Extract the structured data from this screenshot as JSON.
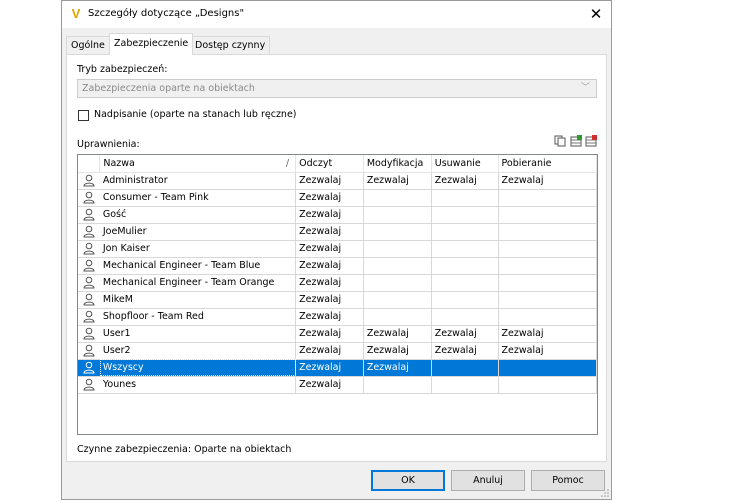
{
  "window": {
    "title": "Szczegóły dotyczące „Designs\"",
    "app_icon": "vault-v-icon",
    "close_glyph": "✕"
  },
  "tabs": [
    {
      "label": "Ogólne",
      "active": false
    },
    {
      "label": "Zabezpieczenie",
      "active": true
    },
    {
      "label": "Dostęp czynny",
      "active": false
    }
  ],
  "security": {
    "mode_label": "Tryb zabezpieczeń:",
    "mode_value": "Zabezpieczenia oparte na obiektach",
    "override_label": "Nadpisanie (oparte na stanach lub ręczne)",
    "override_checked": false,
    "permissions_label": "Uprawnienia:",
    "toolbar_icons": [
      "copy-icon",
      "add-entry-icon",
      "remove-entry-icon"
    ]
  },
  "grid": {
    "columns": [
      "Nazwa",
      "Odczyt",
      "Modyfikacja",
      "Usuwanie",
      "Pobieranie"
    ],
    "sort_marker": "/",
    "rows": [
      {
        "name": "Administrator",
        "read": "Zezwalaj",
        "modify": "Zezwalaj",
        "delete": "Zezwalaj",
        "download": "Zezwalaj"
      },
      {
        "name": "Consumer - Team Pink",
        "read": "Zezwalaj",
        "modify": "",
        "delete": "",
        "download": ""
      },
      {
        "name": "Gość",
        "read": "Zezwalaj",
        "modify": "",
        "delete": "",
        "download": ""
      },
      {
        "name": "JoeMulier",
        "read": "Zezwalaj",
        "modify": "",
        "delete": "",
        "download": ""
      },
      {
        "name": "Jon Kaiser",
        "read": "Zezwalaj",
        "modify": "",
        "delete": "",
        "download": ""
      },
      {
        "name": "Mechanical Engineer - Team Blue",
        "read": "Zezwalaj",
        "modify": "",
        "delete": "",
        "download": ""
      },
      {
        "name": "Mechanical Engineer - Team Orange",
        "read": "Zezwalaj",
        "modify": "",
        "delete": "",
        "download": ""
      },
      {
        "name": "MikeM",
        "read": "Zezwalaj",
        "modify": "",
        "delete": "",
        "download": ""
      },
      {
        "name": "Shopfloor - Team Red",
        "read": "Zezwalaj",
        "modify": "",
        "delete": "",
        "download": ""
      },
      {
        "name": "User1",
        "read": "Zezwalaj",
        "modify": "Zezwalaj",
        "delete": "Zezwalaj",
        "download": "Zezwalaj"
      },
      {
        "name": "User2",
        "read": "Zezwalaj",
        "modify": "Zezwalaj",
        "delete": "Zezwalaj",
        "download": "Zezwalaj"
      },
      {
        "name": "Wszyscy",
        "read": "Zezwalaj",
        "modify": "Zezwalaj",
        "delete": "",
        "download": "",
        "selected": true
      },
      {
        "name": "Younes",
        "read": "Zezwalaj",
        "modify": "",
        "delete": "",
        "download": ""
      }
    ]
  },
  "status_text": "Czynne zabezpieczenia: Oparte na obiektach",
  "buttons": {
    "ok": "OK",
    "cancel": "Anuluj",
    "help": "Pomoc"
  },
  "colors": {
    "selection": "#0078d7",
    "app_icon": "#e8a000"
  }
}
